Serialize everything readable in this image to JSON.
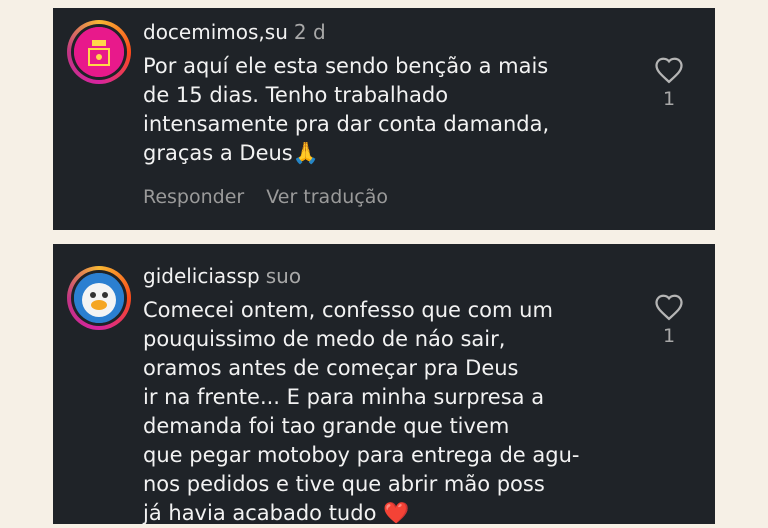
{
  "comments": [
    {
      "username": "docemimos,su",
      "time": "2 d",
      "lines": [
        "Por aquí ele esta sendo benção a mais",
        "de 15 dias. Tenho trabalhado",
        "intensamente pra dar conta damanda,",
        "graças a Deus🙏"
      ],
      "reply_label": "Responder",
      "translate_label": "Ver tradução",
      "likes": "1"
    },
    {
      "username": "gideliciassp",
      "time": "suo",
      "lines": [
        "Comecei ontem, confesso que com um",
        "pouquissimo de medo de náo sair,",
        "oramos antes de começar pra Deus",
        "ir na frente... E para minha surpresa a",
        "demanda foi tao grande que tivem",
        "que pegar motoboy para entrega de agu-",
        "nos pedidos e tive que abrir mão poss",
        "já havia acabado tudo ❤️"
      ],
      "likes": "1"
    }
  ],
  "colors": {
    "background": "#f6f0e6",
    "card": "#1f2328",
    "text": "#f2f2f2",
    "muted": "#a8a8a8"
  },
  "icons": {
    "like": "heart-outline-icon"
  }
}
